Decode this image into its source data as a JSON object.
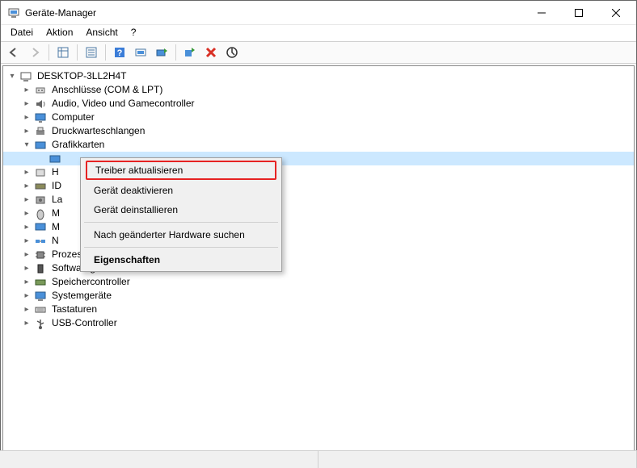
{
  "window": {
    "title": "Geräte-Manager"
  },
  "menu": {
    "file": "Datei",
    "action": "Aktion",
    "view": "Ansicht",
    "help": "?"
  },
  "tree": {
    "root": "DESKTOP-3LL2H4T",
    "items": [
      {
        "label": "Anschlüsse (COM & LPT)"
      },
      {
        "label": "Audio, Video und Gamecontroller"
      },
      {
        "label": "Computer"
      },
      {
        "label": "Druckwarteschlangen"
      },
      {
        "label": "Grafikkarten",
        "expanded": true
      },
      {
        "label": "H",
        "truncated": true
      },
      {
        "label": "ID",
        "truncated": true
      },
      {
        "label": "La",
        "truncated": true
      },
      {
        "label": "M",
        "truncated": true
      },
      {
        "label": "M",
        "truncated": true
      },
      {
        "label": "N",
        "truncated": true
      },
      {
        "label": "Prozessoren"
      },
      {
        "label": "Softwaregeräte"
      },
      {
        "label": "Speichercontroller"
      },
      {
        "label": "Systemgeräte"
      },
      {
        "label": "Tastaturen"
      },
      {
        "label": "USB-Controller"
      }
    ]
  },
  "context_menu": {
    "update_driver": "Treiber aktualisieren",
    "disable_device": "Gerät deaktivieren",
    "uninstall_device": "Gerät deinstallieren",
    "scan_hardware": "Nach geänderter Hardware suchen",
    "properties": "Eigenschaften"
  }
}
